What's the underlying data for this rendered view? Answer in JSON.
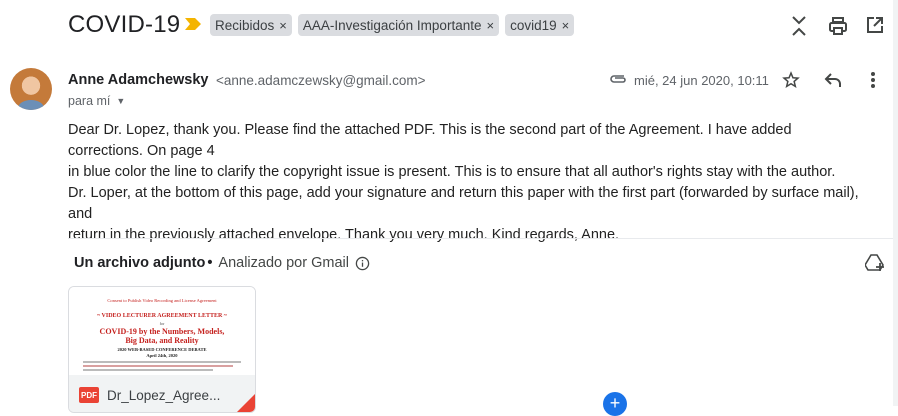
{
  "subject": "COVID-19",
  "labels": [
    {
      "name": "Recibidos",
      "remove": "×"
    },
    {
      "name": "AAA-Investigación Importante",
      "remove": "×"
    },
    {
      "name": "covid19",
      "remove": "×"
    }
  ],
  "sender": {
    "name": "Anne Adamchewsky",
    "email": "<anne.adamczewsky@gmail.com>",
    "to": "para mí",
    "date": "mié, 24 jun 2020, 10:11"
  },
  "body": {
    "line1": "Dear Dr. Lopez, thank you. Please find the attached PDF. This is the second part of the Agreement. I have added corrections. On page 4",
    "line2": "in blue color the line to clarify the copyright issue is present. This is to ensure that all author's rights stay with the author.",
    "line3": "Dr. Loper, at the bottom of this page, add your signature and return this paper with the first part (forwarded by surface mail), and",
    "line4": "return in the previously attached envelope. Thank you very much. Kind regards, Anne."
  },
  "attachments": {
    "count_label": "Un archivo adjunto",
    "dot": "•",
    "scan_status": "Analizado por Gmail",
    "file": {
      "type": "PDF",
      "name": "Dr_Lopez_Agree...",
      "preview": {
        "heading": "Consent to Publish Video Recording and License Agreement",
        "banner": "~ VIDEO LECTURER AGREEMENT LETTER ~",
        "for": "for",
        "title1": "COVID-19 by the Numbers, Models,",
        "title2": "Big Data, and Reality",
        "subtitle": "2020 WEB-BASED CONFERENCE DEBATE",
        "date": "April 24th, 2020"
      }
    }
  },
  "colors": {
    "label_bg": "#dadce0",
    "important": "#f4b400",
    "pdf_red": "#ea4335",
    "accent_blue": "#1a73e8"
  },
  "icons": {
    "important": "importance-marker-icon",
    "expand": "expand-collapse-icon",
    "print": "print-icon",
    "popout": "open-in-new-window-icon",
    "attachment": "paperclip-icon",
    "star": "star-icon",
    "reply": "reply-icon",
    "more": "more-vert-icon",
    "add_drive": "add-to-drive-icon"
  }
}
